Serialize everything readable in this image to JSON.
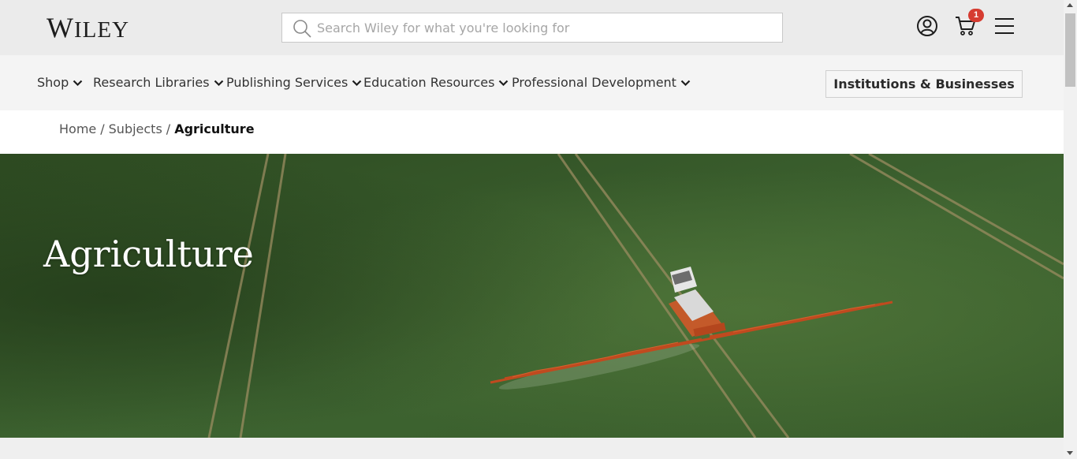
{
  "header": {
    "logo_text": "Wiley",
    "logo_first": "W",
    "logo_rest": "ILEY",
    "search_placeholder": "Search Wiley for what you're looking for",
    "search_value": "",
    "cart_count": "1"
  },
  "nav": {
    "items": [
      {
        "label": "Shop"
      },
      {
        "label": "Research Libraries"
      },
      {
        "label": "Publishing Services"
      },
      {
        "label": "Education Resources"
      },
      {
        "label": "Professional Development"
      }
    ],
    "cta_label": "Institutions & Businesses"
  },
  "breadcrumb": {
    "items": [
      "Home",
      "Subjects"
    ],
    "separator": "/",
    "current": "Agriculture"
  },
  "hero": {
    "title": "Agriculture"
  },
  "colors": {
    "badge": "#d63c31",
    "field_green": "#3b5e2b",
    "header_bg": "#ebebeb"
  },
  "icons": [
    "search-icon",
    "account-icon",
    "cart-icon",
    "menu-icon",
    "chevron-down-icon"
  ]
}
